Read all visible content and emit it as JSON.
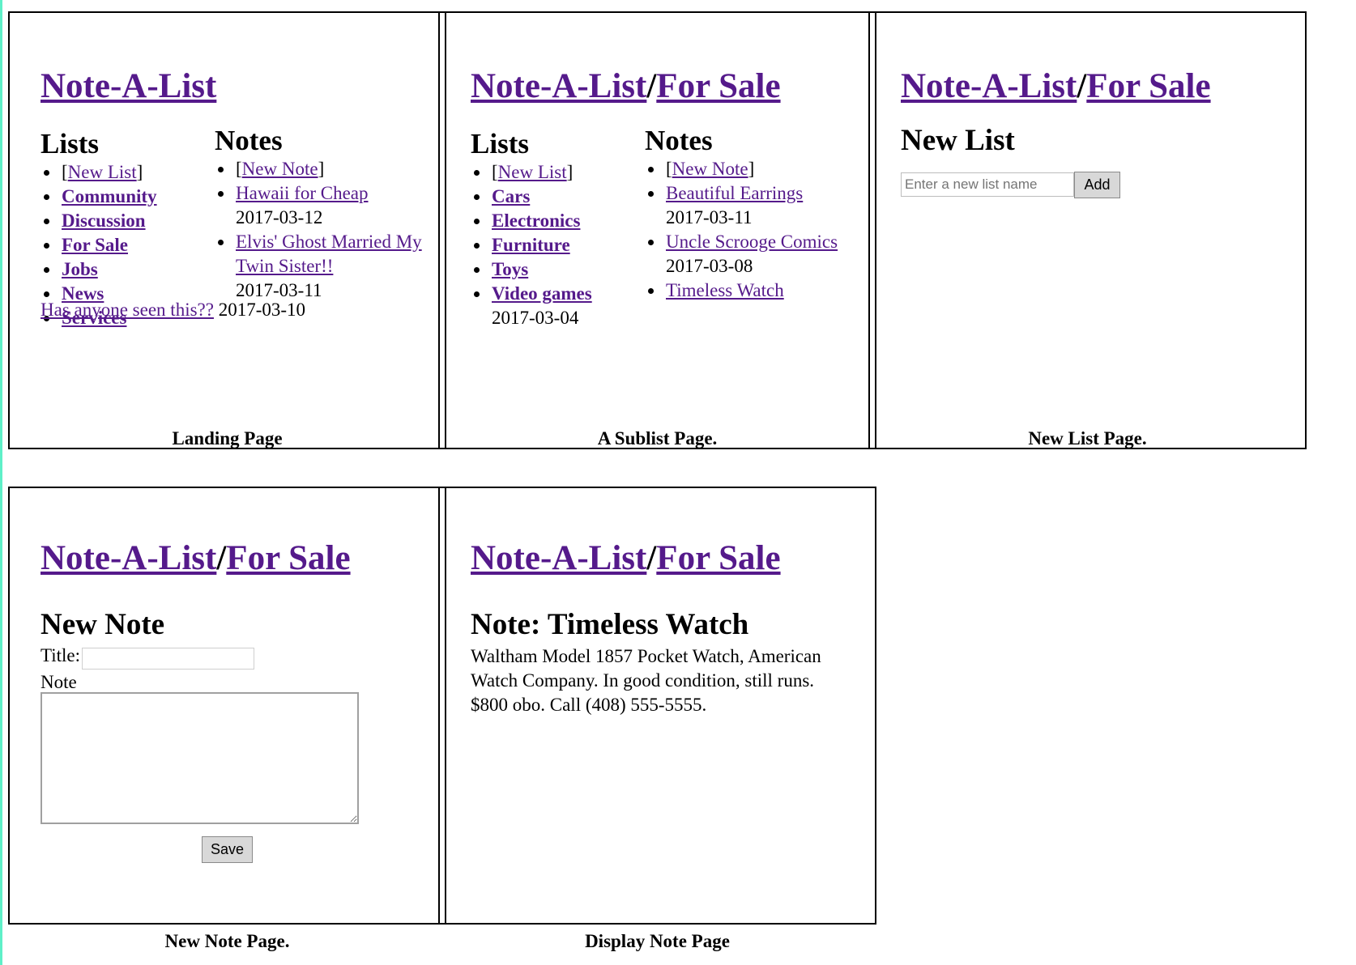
{
  "app_title": "Note-A-List",
  "path_separator": "/",
  "current_list": "For Sale",
  "panels": {
    "landing": {
      "caption": "Landing Page",
      "lists_heading": "Lists",
      "notes_heading": "Notes",
      "new_list_link": "New List",
      "new_note_link": "New Note",
      "lists": [
        "Community",
        "Discussion",
        "For Sale",
        "Jobs",
        "News",
        "Services"
      ],
      "notes": [
        {
          "title": "Hawaii for Cheap",
          "date": "2017-03-12"
        },
        {
          "title": "Elvis' Ghost Married My Twin Sister!!",
          "date": "2017-03-11"
        },
        {
          "title": "Has anyone seen this??",
          "date": "2017-03-10"
        }
      ]
    },
    "sublist": {
      "caption": "A Sublist Page.",
      "lists_heading": "Lists",
      "notes_heading": "Notes",
      "new_list_link": "New List",
      "new_note_link": "New Note",
      "lists": [
        "Cars",
        "Electronics",
        "Furniture",
        "Toys",
        "Video games"
      ],
      "lists_trailing_date": "2017-03-04",
      "notes": [
        {
          "title": "Beautiful Earrings",
          "date": "2017-03-11"
        },
        {
          "title": "Uncle Scroogе Comics",
          "date": "2017-03-08"
        },
        {
          "title": "Timeless Watch",
          "date": ""
        }
      ]
    },
    "new_list": {
      "caption": "New List Page.",
      "heading": "New List",
      "input_placeholder": "Enter a new list name",
      "add_button": "Add"
    },
    "new_note": {
      "caption": "New Note Page.",
      "heading": "New Note",
      "title_label": "Title:",
      "note_label": "Note",
      "save_button": "Save"
    },
    "display_note": {
      "caption": "Display Note Page",
      "heading": "Note: Timeless Watch",
      "body": "Waltham Model 1857 Pocket Watch, American Watch Company. In good condition, still runs. $800 obo. Call (408) 555-5555."
    }
  },
  "colors": {
    "link": "#551a8b",
    "left_edge_accent": "#5ff0c8"
  }
}
